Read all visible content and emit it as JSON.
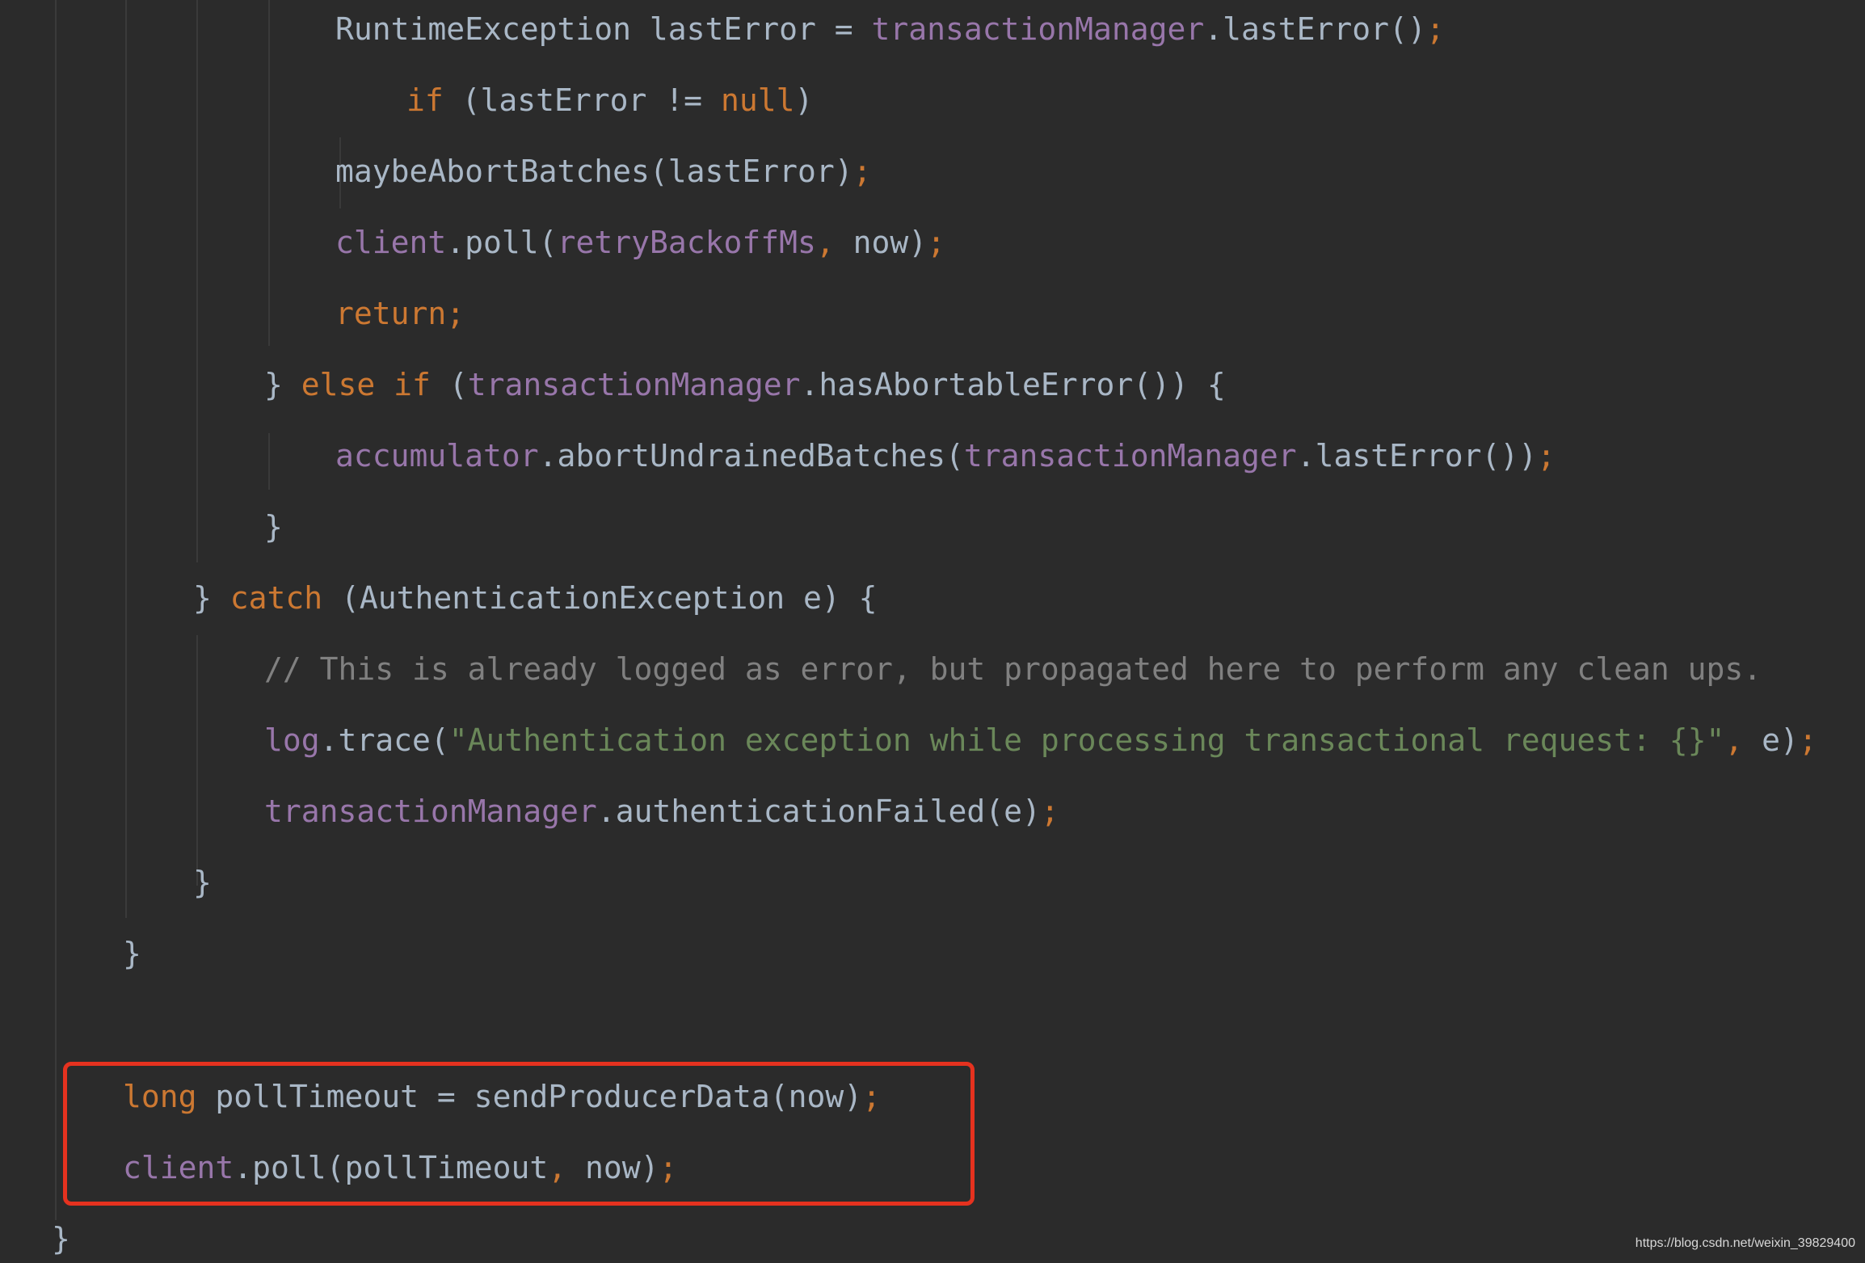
{
  "editor": {
    "colors": {
      "background": "#2b2b2b",
      "plain": "#a9b7c6",
      "keyword": "#cc7832",
      "field": "#9876aa",
      "string": "#6a8759",
      "comment": "#808080",
      "highlight_border": "#e5321f"
    },
    "lines": [
      [
        {
          "t": "RuntimeException lastError = ",
          "c": "plain"
        },
        {
          "t": "transactionManager",
          "c": "field"
        },
        {
          "t": ".lastError()",
          "c": "plain"
        },
        {
          "t": ";",
          "c": "punct"
        }
      ],
      [
        {
          "t": "if",
          "c": "kw"
        },
        {
          "t": " (lastError != ",
          "c": "plain"
        },
        {
          "t": "null",
          "c": "kw"
        },
        {
          "t": ")",
          "c": "plain"
        }
      ],
      [
        {
          "t": "maybeAbortBatches(lastError)",
          "c": "plain"
        },
        {
          "t": ";",
          "c": "punct"
        }
      ],
      [
        {
          "t": "client",
          "c": "field"
        },
        {
          "t": ".poll(",
          "c": "plain"
        },
        {
          "t": "retryBackoffMs",
          "c": "field"
        },
        {
          "t": ",",
          "c": "punct"
        },
        {
          "t": " now)",
          "c": "plain"
        },
        {
          "t": ";",
          "c": "punct"
        }
      ],
      [
        {
          "t": "return;",
          "c": "kw"
        }
      ],
      [
        {
          "t": "} ",
          "c": "plain"
        },
        {
          "t": "else if",
          "c": "kw"
        },
        {
          "t": " (",
          "c": "plain"
        },
        {
          "t": "transactionManager",
          "c": "field"
        },
        {
          "t": ".hasAbortableError()) {",
          "c": "plain"
        }
      ],
      [
        {
          "t": "accumulator",
          "c": "field"
        },
        {
          "t": ".abortUndrainedBatches(",
          "c": "plain"
        },
        {
          "t": "transactionManager",
          "c": "field"
        },
        {
          "t": ".lastError())",
          "c": "plain"
        },
        {
          "t": ";",
          "c": "punct"
        }
      ],
      [
        {
          "t": "}",
          "c": "plain"
        }
      ],
      [
        {
          "t": "} ",
          "c": "plain"
        },
        {
          "t": "catch",
          "c": "kw"
        },
        {
          "t": " (AuthenticationException e) {",
          "c": "plain"
        }
      ],
      [
        {
          "t": "// This is already logged as error, but propagated here to perform any clean ups.",
          "c": "comment"
        }
      ],
      [
        {
          "t": "log",
          "c": "field"
        },
        {
          "t": ".trace(",
          "c": "plain"
        },
        {
          "t": "\"Authentication exception while processing transactional request: {}\"",
          "c": "str"
        },
        {
          "t": ",",
          "c": "punct"
        },
        {
          "t": " e)",
          "c": "plain"
        },
        {
          "t": ";",
          "c": "punct"
        }
      ],
      [
        {
          "t": "transactionManager",
          "c": "field"
        },
        {
          "t": ".authenticationFailed(e)",
          "c": "plain"
        },
        {
          "t": ";",
          "c": "punct"
        }
      ],
      [
        {
          "t": "}",
          "c": "plain"
        }
      ],
      [
        {
          "t": "}",
          "c": "plain"
        }
      ],
      [],
      [
        {
          "t": "long",
          "c": "kw"
        },
        {
          "t": " pollTimeout = sendProducerData(now)",
          "c": "plain"
        },
        {
          "t": ";",
          "c": "punct"
        }
      ],
      [
        {
          "t": "client",
          "c": "field"
        },
        {
          "t": ".poll(pollTimeout",
          "c": "plain"
        },
        {
          "t": ",",
          "c": "punct"
        },
        {
          "t": " now)",
          "c": "plain"
        },
        {
          "t": ";",
          "c": "punct"
        }
      ],
      [
        {
          "t": "}",
          "c": "plain"
        }
      ]
    ]
  },
  "watermark": "https://blog.csdn.net/weixin_39829400"
}
